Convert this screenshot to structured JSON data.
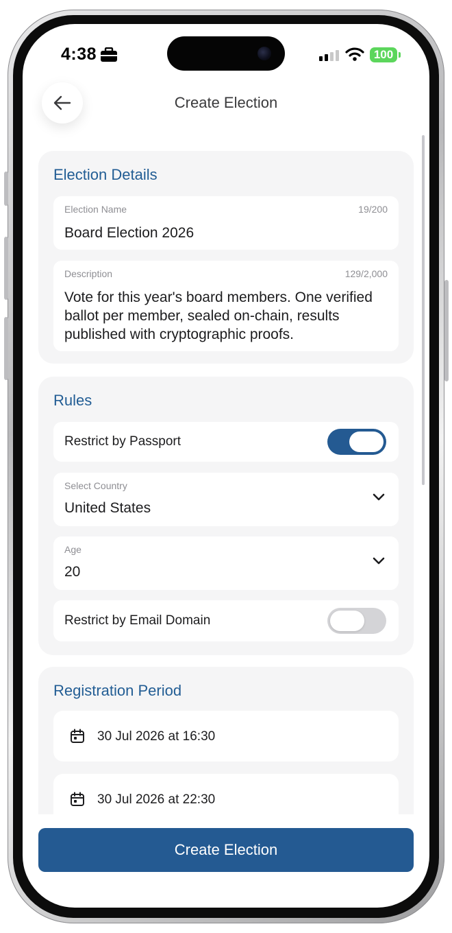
{
  "status_bar": {
    "time": "4:38",
    "battery": "100"
  },
  "header": {
    "title": "Create Election"
  },
  "election_details": {
    "section_title": "Election Details",
    "name_label": "Election Name",
    "name_counter": "19/200",
    "name_value": "Board Election 2026",
    "description_label": "Description",
    "description_counter": "129/2,000",
    "description_value": "Vote for this year's board members. One verified ballot per member, sealed on-chain, results published with cryptographic proofs."
  },
  "rules": {
    "section_title": "Rules",
    "restrict_passport_label": "Restrict by Passport",
    "restrict_passport_on": true,
    "country_label": "Select Country",
    "country_value": "United States",
    "age_label": "Age",
    "age_value": "20",
    "restrict_email_label": "Restrict by Email Domain",
    "restrict_email_on": false
  },
  "registration_period": {
    "section_title": "Registration Period",
    "start": "30 Jul 2026 at 16:30",
    "end": "30 Jul 2026 at 22:30"
  },
  "footer": {
    "create_button": "Create Election"
  },
  "colors": {
    "accent": "#245a92",
    "section_title": "#225d94",
    "card_bg": "#f5f5f6"
  }
}
